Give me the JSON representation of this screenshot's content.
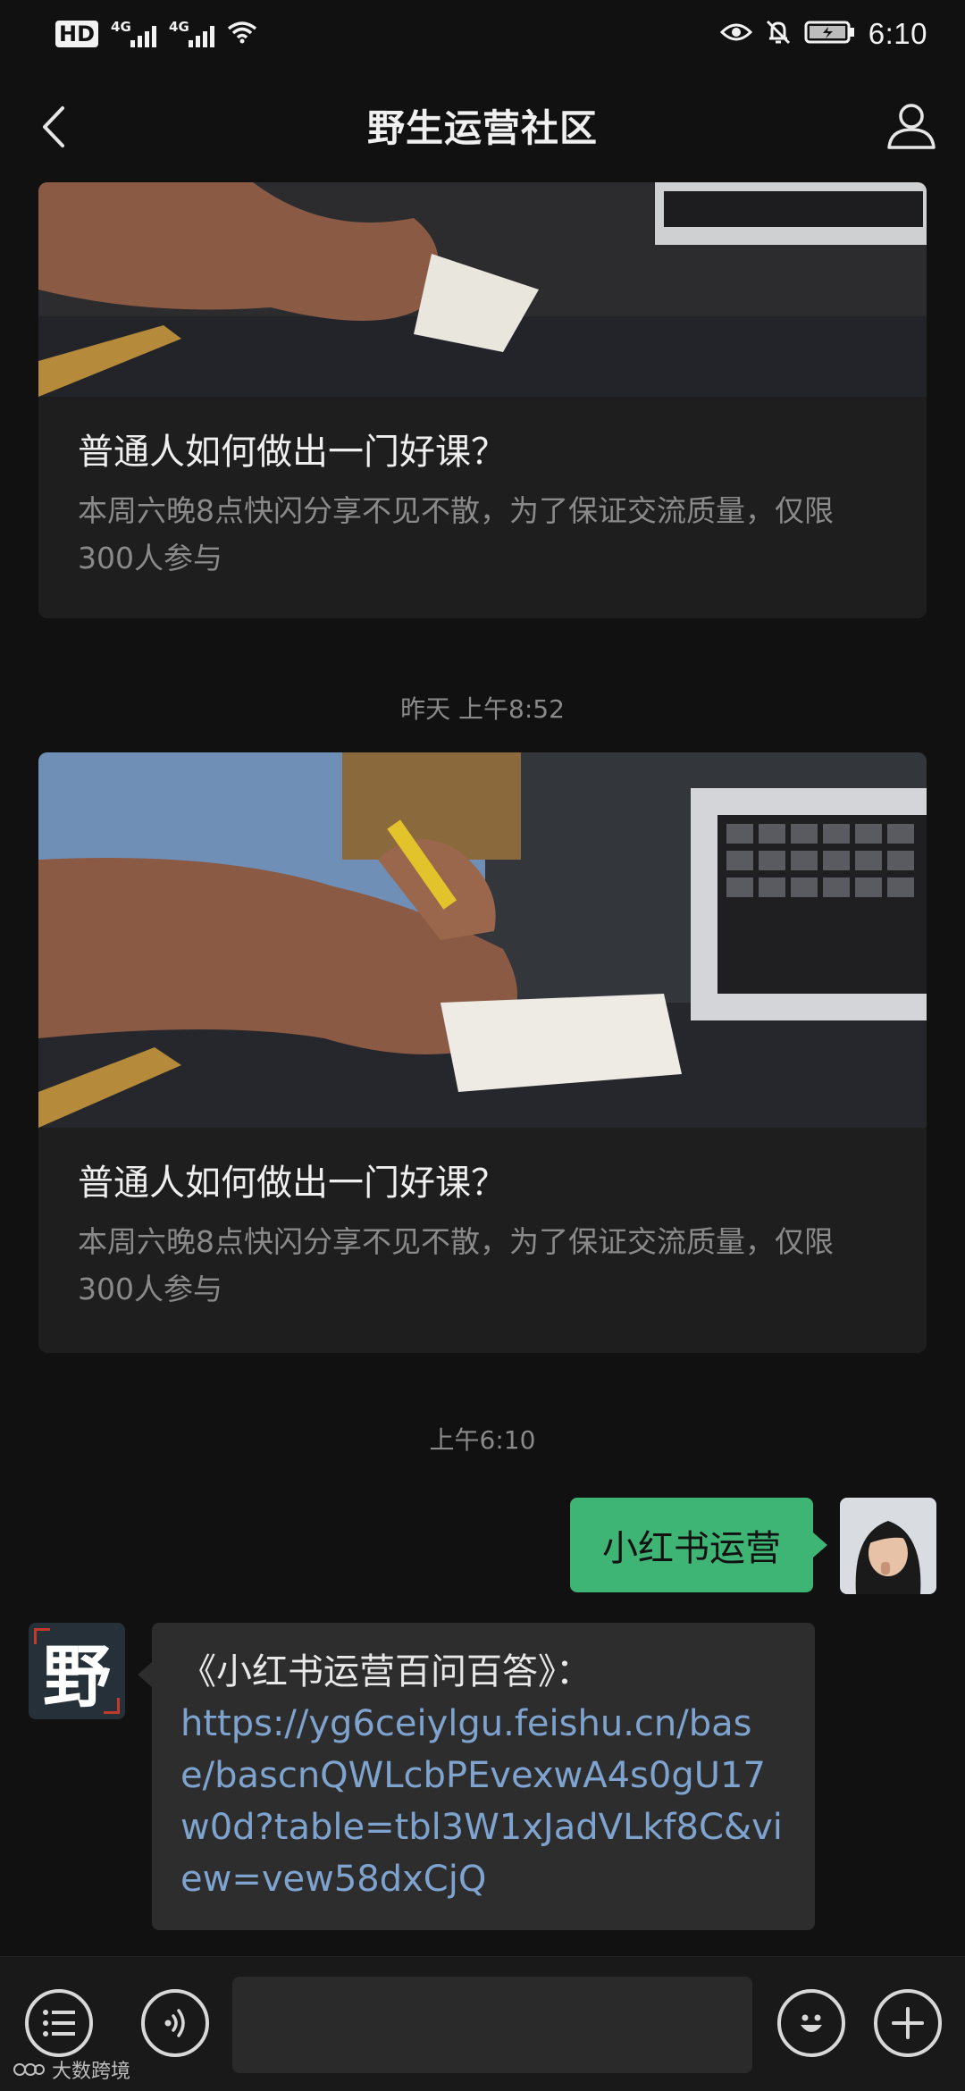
{
  "status_bar": {
    "hd": "HD",
    "network_1": "4G",
    "network_2": "4G",
    "time": "6:10"
  },
  "header": {
    "title": "野生运营社区"
  },
  "messages": {
    "card1": {
      "title": "普通人如何做出一门好课？",
      "desc": "本周六晚8点快闪分享不见不散，为了保证交流质量，仅限300人参与"
    },
    "timestamp1": "昨天 上午8:52",
    "card2": {
      "title": "普通人如何做出一门好课？",
      "desc": "本周六晚8点快闪分享不见不散，为了保证交流质量，仅限300人参与"
    },
    "timestamp2": "上午6:10",
    "outgoing": {
      "text": "小红书运营"
    },
    "incoming": {
      "avatar_char": "野",
      "line1": "《小红书运营百问百答》：",
      "link": "https://yg6ceiylgu.feishu.cn/base/bascnQWLcbPEvexwA4s0gU17w0d?table=tbl3W1xJadVLkf8C&view=vew58dxCjQ"
    }
  },
  "watermark": {
    "text": "大数跨境"
  },
  "colors": {
    "background": "#111111",
    "bubble_out": "#3eb575",
    "bubble_in": "#2d2d2d",
    "link": "#7fa3cf"
  }
}
